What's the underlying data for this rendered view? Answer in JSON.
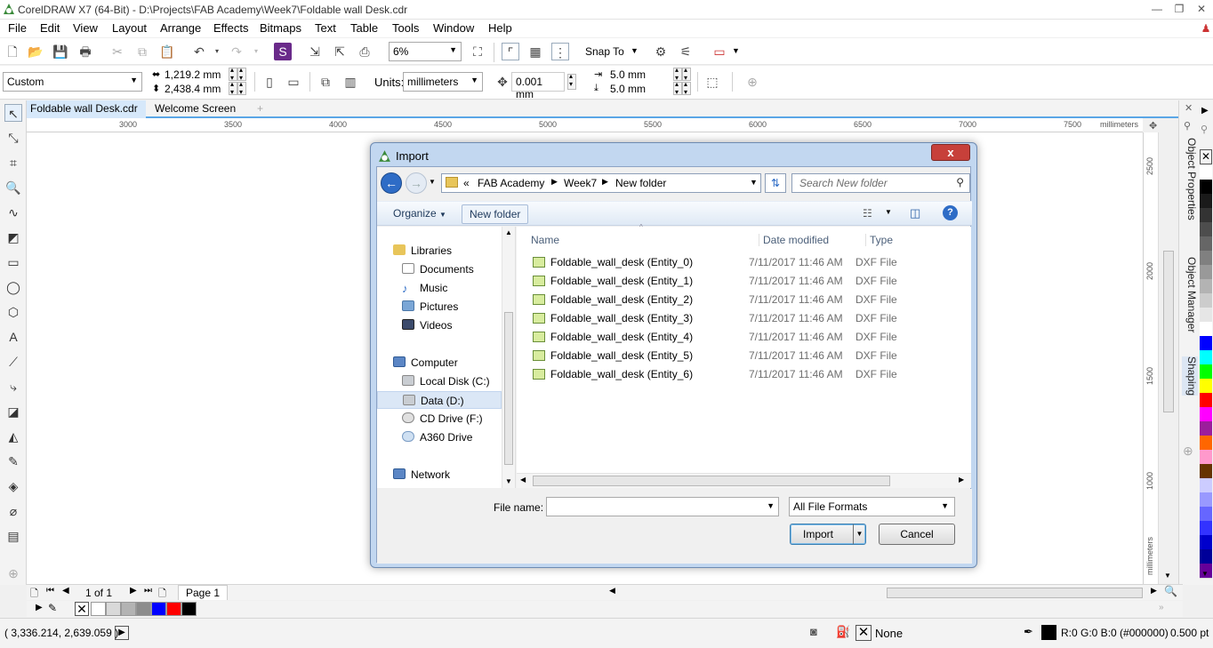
{
  "window": {
    "title": "CorelDRAW X7 (64-Bit) - D:\\Projects\\FAB Academy\\Week7\\Foldable wall Desk.cdr"
  },
  "menu": [
    "File",
    "Edit",
    "View",
    "Layout",
    "Arrange",
    "Effects",
    "Bitmaps",
    "Text",
    "Table",
    "Tools",
    "Window",
    "Help"
  ],
  "toolbar": {
    "zoom": "6%",
    "snap_to": "Snap To"
  },
  "property_bar": {
    "page_size": "Custom",
    "width": "1,219.2 mm",
    "height": "2,438.4 mm",
    "units_label": "Units:",
    "units_value": "millimeters",
    "nudge": "0.001 mm",
    "dup_x": "5.0 mm",
    "dup_y": "5.0 mm"
  },
  "doc_tabs": [
    "Foldable wall Desk.cdr",
    "Welcome Screen"
  ],
  "ruler": {
    "h_ticks": [
      "3000",
      "3500",
      "4000",
      "4500",
      "5000",
      "5500",
      "6000",
      "6500",
      "7000",
      "7500"
    ],
    "h_unit": "millimeters",
    "v_ticks": [
      "2500",
      "2000",
      "1500",
      "1000"
    ],
    "v_unit": "millimeters"
  },
  "dockers": [
    "Object Properties",
    "Object Manager",
    "Shaping"
  ],
  "palette_colors": [
    "#ffffff",
    "#000000",
    "#1a1a1a",
    "#333333",
    "#4d4d4d",
    "#666666",
    "#808080",
    "#999999",
    "#b3b3b3",
    "#cccccc",
    "#e6e6e6",
    "#ffffff",
    "#0000ff",
    "#00ffff",
    "#00ff00",
    "#ffff00",
    "#ff0000",
    "#ff00ff",
    "#9c1d9c",
    "#ff6600",
    "#ff99cc",
    "#663300",
    "#ccccff",
    "#9999ff",
    "#6666ff",
    "#3333ff",
    "#0000cc",
    "#000099",
    "#660099"
  ],
  "page_nav": {
    "page_count": "1 of 1",
    "page_tab": "Page 1"
  },
  "doc_palette": [
    "#ffffff",
    "#d9d9d9",
    "#b3b3b3",
    "#8c8c8c",
    "#0000ff",
    "#ff0000",
    "#000000"
  ],
  "status": {
    "coords": "( 3,336.214, 2,639.059 )",
    "fill": "None",
    "outline": "R:0 G:0 B:0 (#000000)",
    "outline_width": "0.500 pt"
  },
  "dialog": {
    "title": "Import",
    "close": "x",
    "breadcrumb": [
      "FAB Academy",
      "Week7",
      "New folder"
    ],
    "breadcrumb_prefix": "«",
    "search_placeholder": "Search New folder",
    "organize": "Organize",
    "new_folder": "New folder",
    "nav": {
      "libraries": "Libraries",
      "library_items": [
        "Documents",
        "Music",
        "Pictures",
        "Videos"
      ],
      "computer": "Computer",
      "drives": [
        "Local Disk (C:)",
        "Data (D:)",
        "CD Drive (F:)",
        "A360 Drive"
      ],
      "network": "Network"
    },
    "columns": [
      "Name",
      "Date modified",
      "Type"
    ],
    "files": [
      {
        "name": "Foldable_wall_desk (Entity_0)",
        "date": "7/11/2017 11:46 AM",
        "type": "DXF File"
      },
      {
        "name": "Foldable_wall_desk (Entity_1)",
        "date": "7/11/2017 11:46 AM",
        "type": "DXF File"
      },
      {
        "name": "Foldable_wall_desk (Entity_2)",
        "date": "7/11/2017 11:46 AM",
        "type": "DXF File"
      },
      {
        "name": "Foldable_wall_desk (Entity_3)",
        "date": "7/11/2017 11:46 AM",
        "type": "DXF File"
      },
      {
        "name": "Foldable_wall_desk (Entity_4)",
        "date": "7/11/2017 11:46 AM",
        "type": "DXF File"
      },
      {
        "name": "Foldable_wall_desk (Entity_5)",
        "date": "7/11/2017 11:46 AM",
        "type": "DXF File"
      },
      {
        "name": "Foldable_wall_desk (Entity_6)",
        "date": "7/11/2017 11:46 AM",
        "type": "DXF File"
      }
    ],
    "file_name_label": "File name:",
    "file_name_value": "",
    "file_type": "All File Formats",
    "import_button": "Import",
    "cancel_button": "Cancel"
  }
}
